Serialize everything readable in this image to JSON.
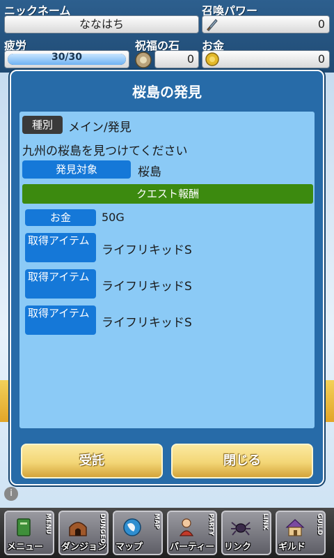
{
  "status": {
    "nickname_label": "ニックネーム",
    "nickname_value": "ななはち",
    "summon_label": "召喚パワー",
    "summon_value": "0",
    "fatigue_label": "疲労",
    "fatigue_value": "30/30",
    "fatigue_ratio": 1.0,
    "stone_label": "祝福の石",
    "stone_value": "0",
    "money_label": "お金",
    "money_value": "0"
  },
  "dialog": {
    "title": "桜島の発見",
    "type_tag": "種別",
    "type_value": "メイン/発見",
    "description": "九州の桜島を見つけてください",
    "target_tag": "発見対象",
    "target_value": "桜島",
    "reward_header": "クエスト報酬",
    "rewards": [
      {
        "tag": "お金",
        "value": "50G"
      },
      {
        "tag": "取得アイテム",
        "value": "ライフリキッドS"
      },
      {
        "tag": "取得アイテム",
        "value": "ライフリキッドS"
      },
      {
        "tag": "取得アイテム",
        "value": "ライフリキッドS"
      }
    ],
    "accept_label": "受託",
    "close_label": "閉じる"
  },
  "scene": {
    "info_icon": "i"
  },
  "nav": {
    "items": [
      {
        "en": "MENU",
        "jp": "メニュー",
        "icon": "menu-book-icon"
      },
      {
        "en": "DUNGEON",
        "jp": "ダンジョン",
        "icon": "dungeon-icon"
      },
      {
        "en": "MAP",
        "jp": "マップ",
        "icon": "map-globe-icon"
      },
      {
        "en": "PARTY",
        "jp": "パーティー",
        "icon": "party-character-icon"
      },
      {
        "en": "LINK",
        "jp": "リンク",
        "icon": "link-spider-icon"
      },
      {
        "en": "GUILD",
        "jp": "ギルド",
        "icon": "guild-house-icon"
      }
    ]
  },
  "colors": {
    "dialog_bg": "#276ba8",
    "body_bg": "#8bcaf6",
    "tag_blue": "#1578d8",
    "reward_green": "#3c8a0f",
    "button_gold": "#f3d676"
  }
}
